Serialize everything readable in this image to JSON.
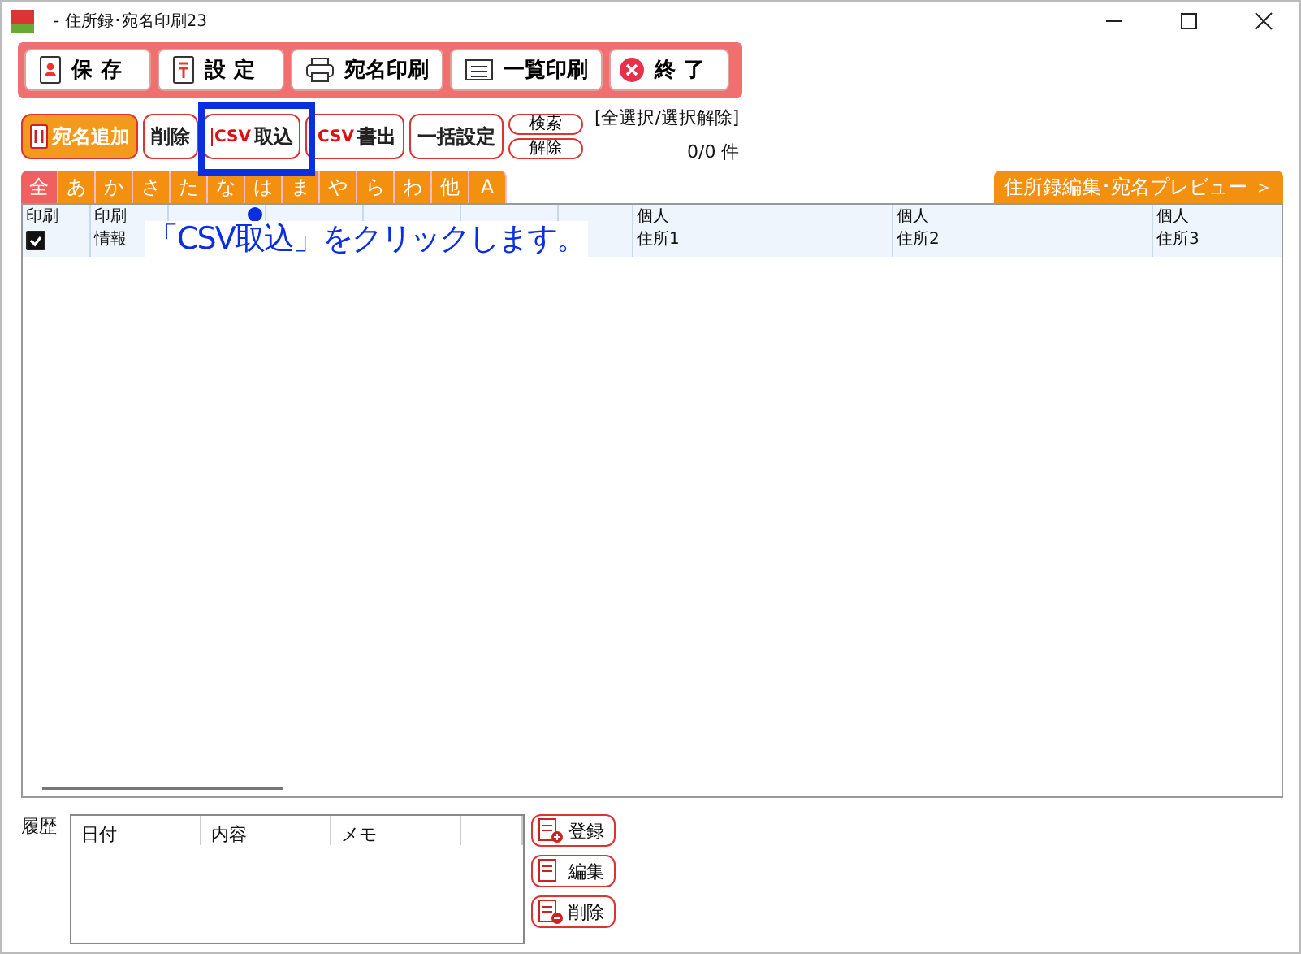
{
  "window": {
    "title": "- 住所録･宛名印刷23"
  },
  "toolbar": [
    {
      "label": "保存",
      "kind": "save"
    },
    {
      "label": "設定",
      "kind": "settings"
    },
    {
      "label": "宛名印刷",
      "kind": "print"
    },
    {
      "label": "一覧印刷",
      "kind": "list"
    },
    {
      "label": "終了",
      "kind": "exit"
    }
  ],
  "actions": [
    {
      "label": "宛名追加",
      "kind": "primary"
    },
    {
      "label": "削除",
      "kind": "plain"
    },
    {
      "label": "取込",
      "kind": "csv"
    },
    {
      "label": "書出",
      "kind": "csv"
    },
    {
      "label": "一括設定",
      "kind": "plain"
    }
  ],
  "csv_mark": [
    "CSV",
    "CSV"
  ],
  "search_buttons": [
    "検索",
    "解除"
  ],
  "select_all": "[全選択/選択解除]",
  "count": "0/0 件",
  "index_tabs": [
    {
      "label": "全",
      "selected": true
    },
    {
      "label": "あ",
      "selected": false
    },
    {
      "label": "か",
      "selected": false
    },
    {
      "label": "さ",
      "selected": false
    },
    {
      "label": "た",
      "selected": false
    },
    {
      "label": "な",
      "selected": false
    },
    {
      "label": "は",
      "selected": false
    },
    {
      "label": "ま",
      "selected": false
    },
    {
      "label": "や",
      "selected": false
    },
    {
      "label": "ら",
      "selected": false
    },
    {
      "label": "わ",
      "selected": false
    },
    {
      "label": "他",
      "selected": false
    },
    {
      "label": "A",
      "selected": false
    }
  ],
  "preview_button": "住所録編集･宛名プレビュー ＞",
  "table": {
    "print_all_checked": true,
    "columns": [
      {
        "lines": [
          "印刷"
        ]
      },
      {
        "lines": [
          "印刷",
          "情報"
        ]
      },
      {},
      {},
      {},
      {},
      {},
      {
        "lines": [
          "個人",
          "住所1"
        ]
      },
      {
        "lines": [
          "個人",
          "住所2"
        ]
      },
      {
        "lines": [
          "個人",
          "住所3"
        ]
      }
    ]
  },
  "history": {
    "label": "履歴",
    "columns": [
      "日付",
      "内容",
      "メモ"
    ],
    "buttons": [
      {
        "label": "登録",
        "kind": "add"
      },
      {
        "label": "編集",
        "kind": "edit"
      },
      {
        "label": "削除",
        "kind": "remove"
      }
    ]
  },
  "callout": {
    "text": "「CSV取込」をクリックします。"
  }
}
